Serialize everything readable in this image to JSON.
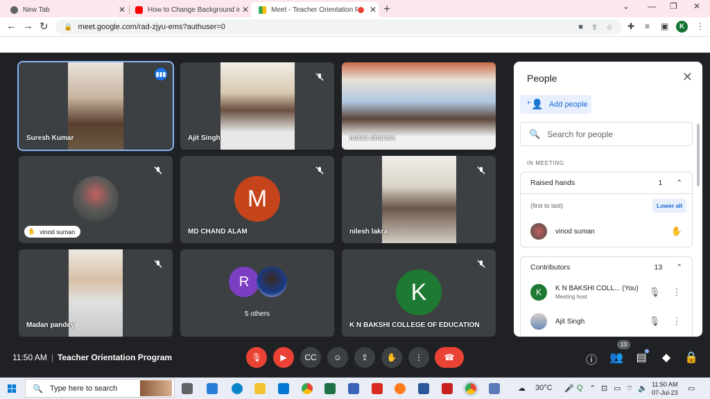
{
  "tabs": [
    {
      "title": "New Tab",
      "active": false
    },
    {
      "title": "How to Change Background in G",
      "active": false
    },
    {
      "title": "Meet - Teacher Orientation P",
      "active": true
    }
  ],
  "toolbar": {
    "url": "meet.google.com/rad-zjyu-ems?authuser=0",
    "profile_initial": "K"
  },
  "tiles": [
    {
      "name": "Suresh Kumar",
      "type": "video",
      "speaking": true,
      "accent": "#9a8a7a"
    },
    {
      "name": "Ajit Singh",
      "type": "video",
      "muted": true,
      "accent": "#b8a890"
    },
    {
      "name": "nutan sharma",
      "type": "video",
      "muted": false,
      "accent": "#a86c5c"
    },
    {
      "name": "vinod suman",
      "type": "avatar_photo",
      "muted": true,
      "raised_hand": true
    },
    {
      "name": "MD CHAND ALAM",
      "type": "letter",
      "letter": "M",
      "color": "#c5441b",
      "muted": true
    },
    {
      "name": "nilesh lakra",
      "type": "video",
      "muted": true,
      "accent": "#8a8478"
    },
    {
      "name": "Madan pandey",
      "type": "video",
      "muted": true,
      "accent": "#c8c0b0"
    },
    {
      "name": "5 others",
      "type": "others",
      "letter": "R",
      "color": "#7b3ec3"
    },
    {
      "name": "K N BAKSHI COLLEGE OF EDUCATION",
      "type": "letter",
      "letter": "K",
      "color": "#1e7a32",
      "muted": true
    }
  ],
  "people": {
    "title": "People",
    "add_label": "Add people",
    "search_placeholder": "Search for people",
    "in_meeting": "IN MEETING",
    "raised": {
      "label": "Raised hands",
      "count": "1",
      "order": "(first to last)",
      "lower_all": "Lower all",
      "person": "vinod suman"
    },
    "contributors": {
      "label": "Contributors",
      "count": "13",
      "people": [
        {
          "name": "K N BAKSHI COLL...",
          "you": "(You)",
          "role": "Meeting host",
          "initial": "K"
        },
        {
          "name": "Ajit Singh"
        }
      ]
    }
  },
  "bottom": {
    "time": "11:50 AM",
    "meeting": "Teacher Orientation Program",
    "participant_count": "13"
  },
  "taskbar": {
    "search_placeholder": "Type here to search",
    "weather": "30°C",
    "time": "11:50 AM",
    "date": "07-Jul-23"
  }
}
